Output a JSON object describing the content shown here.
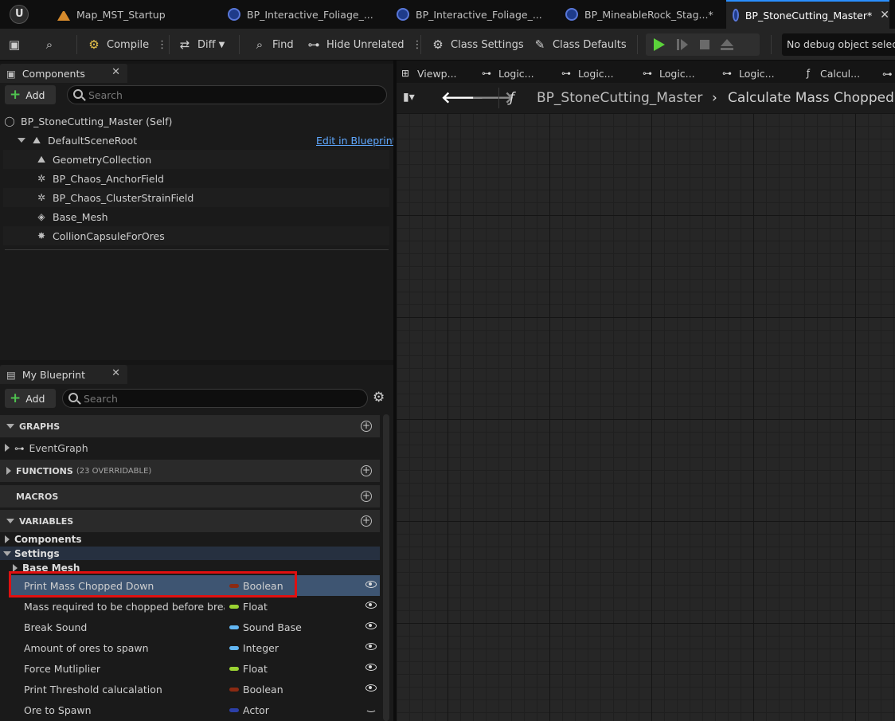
{
  "tabs": [
    {
      "label": "Map_MST_Startup",
      "icon": "map-icon"
    },
    {
      "label": "BP_Interactive_Foliage_...",
      "icon": "blueprint-icon"
    },
    {
      "label": "BP_Interactive_Foliage_...",
      "icon": "blueprint-icon"
    },
    {
      "label": "BP_MineableRock_Stag...*",
      "icon": "blueprint-icon"
    },
    {
      "label": "BP_StoneCutting_Master*",
      "icon": "blueprint-icon",
      "active": true
    }
  ],
  "toolbar": {
    "compile": "Compile",
    "diff": "Diff",
    "find": "Find",
    "hide_unrelated": "Hide Unrelated",
    "class_settings": "Class Settings",
    "class_defaults": "Class Defaults",
    "debug_object": "No debug object selected"
  },
  "components_panel": {
    "title": "Components",
    "add_label": "Add",
    "search_placeholder": "Search",
    "root": "BP_StoneCutting_Master (Self)",
    "edit_link": "Edit in Blueprint",
    "items": [
      {
        "label": "DefaultSceneRoot",
        "icon": "scene-root-icon"
      },
      {
        "label": "GeometryCollection",
        "icon": "geometry-collection-icon"
      },
      {
        "label": "BP_Chaos_AnchorField",
        "icon": "field-icon"
      },
      {
        "label": "BP_Chaos_ClusterStrainField",
        "icon": "field-icon"
      },
      {
        "label": "Base_Mesh",
        "icon": "static-mesh-icon"
      },
      {
        "label": "CollionCapsuleForOres",
        "icon": "capsule-icon"
      }
    ]
  },
  "my_blueprint": {
    "title": "My Blueprint",
    "add_label": "Add",
    "search_placeholder": "Search",
    "sections": {
      "graphs": "GRAPHS",
      "functions": "FUNCTIONS",
      "functions_sub": "(23 OVERRIDABLE)",
      "macros": "MACROS",
      "variables": "VARIABLES"
    },
    "event_graph": "EventGraph",
    "categories": {
      "components": "Components",
      "settings": "Settings",
      "base_mesh": "Base Mesh"
    },
    "variables": [
      {
        "name": "Print Mass Chopped Down",
        "type": "Boolean",
        "color": "#8b2a12",
        "visible": true,
        "selected": true
      },
      {
        "name": "Mass required to be chopped before breaking",
        "type": "Float",
        "color": "#9ad232",
        "visible": true
      },
      {
        "name": "Break Sound",
        "type": "Sound Base",
        "color": "#62b6f2",
        "visible": true
      },
      {
        "name": "Amount of ores to spawn",
        "type": "Integer",
        "color": "#62b6f2",
        "visible": true
      },
      {
        "name": "Force Mutliplier",
        "type": "Float",
        "color": "#9ad232",
        "visible": true
      },
      {
        "name": "Print Threshold calucalation",
        "type": "Boolean",
        "color": "#8b2a12",
        "visible": true
      },
      {
        "name": "Ore to Spawn",
        "type": "Actor",
        "color": "#2c3fa8",
        "visible": false
      }
    ]
  },
  "graph_tabs": [
    {
      "label": "Viewp...",
      "icon": "viewport-icon"
    },
    {
      "label": "Logic...",
      "icon": "logic-graph-icon"
    },
    {
      "label": "Logic...",
      "icon": "logic-graph-icon"
    },
    {
      "label": "Logic...",
      "icon": "logic-graph-icon"
    },
    {
      "label": "Logic...",
      "icon": "logic-graph-icon"
    },
    {
      "label": "Calcul...",
      "icon": "function-icon"
    }
  ],
  "breadcrumb": {
    "blueprint": "BP_StoneCutting_Master",
    "graph": "Calculate Mass Chopped"
  }
}
